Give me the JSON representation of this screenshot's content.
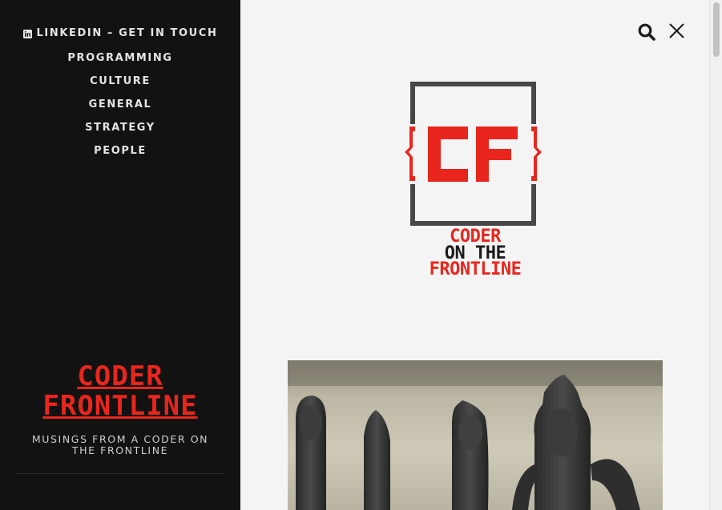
{
  "sidebar": {
    "nav": [
      {
        "label": "LINKEDIN – GET IN TOUCH",
        "icon": "linkedin-icon"
      },
      {
        "label": "PROGRAMMING"
      },
      {
        "label": "CULTURE"
      },
      {
        "label": "GENERAL"
      },
      {
        "label": "STRATEGY"
      },
      {
        "label": "PEOPLE"
      }
    ],
    "site_title": {
      "line1": "CODER",
      "line2": "FRONTLINE"
    },
    "tagline": "MUSINGS FROM A CODER ON THE FRONTLINE"
  },
  "header": {
    "search_icon": "search-icon",
    "close_icon": "close-icon"
  },
  "logo": {
    "mark": "{CF}",
    "line1": "CODER",
    "line2": "ON THE",
    "line3": "FRONTLINE"
  },
  "colors": {
    "accent": "#e8261d",
    "sidebar_bg": "#121212",
    "main_bg": "#f4f4f4",
    "logo_frame": "#474747"
  }
}
